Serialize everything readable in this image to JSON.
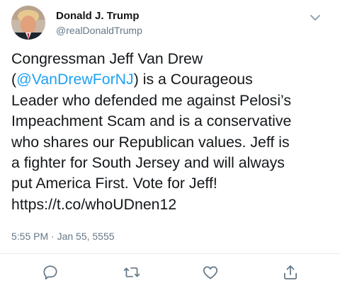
{
  "user": {
    "display_name": "Donald J. Trump",
    "handle": "@realDonaldTrump",
    "avatar_icon": "avatar-photo"
  },
  "tweet": {
    "line1": "Congressman Jeff Van Drew",
    "line2_prefix": "(",
    "mention": "@VanDrewForNJ",
    "line2_suffix": ") is a Courageous",
    "line3": "Leader who defended me against Pelosi’s",
    "line4": "Impeachment Scam and is a conservative",
    "line5": "who shares our Republican values. Jeff is",
    "line6": "a fighter for South Jersey and will always",
    "line7": "put America First. Vote for Jeff!",
    "line8": "https://t.co/whoUDnen12"
  },
  "meta": {
    "timestamp": "5:55 PM · Jan 55, 5555"
  },
  "actions": {
    "reply_icon": "reply-icon",
    "retweet_icon": "retweet-icon",
    "like_icon": "heart-icon",
    "share_icon": "share-icon",
    "icon_color": "#657786"
  },
  "colors": {
    "link": "#1da1f2",
    "text": "#14171a",
    "muted": "#657786",
    "divider": "#e6ecf0"
  }
}
